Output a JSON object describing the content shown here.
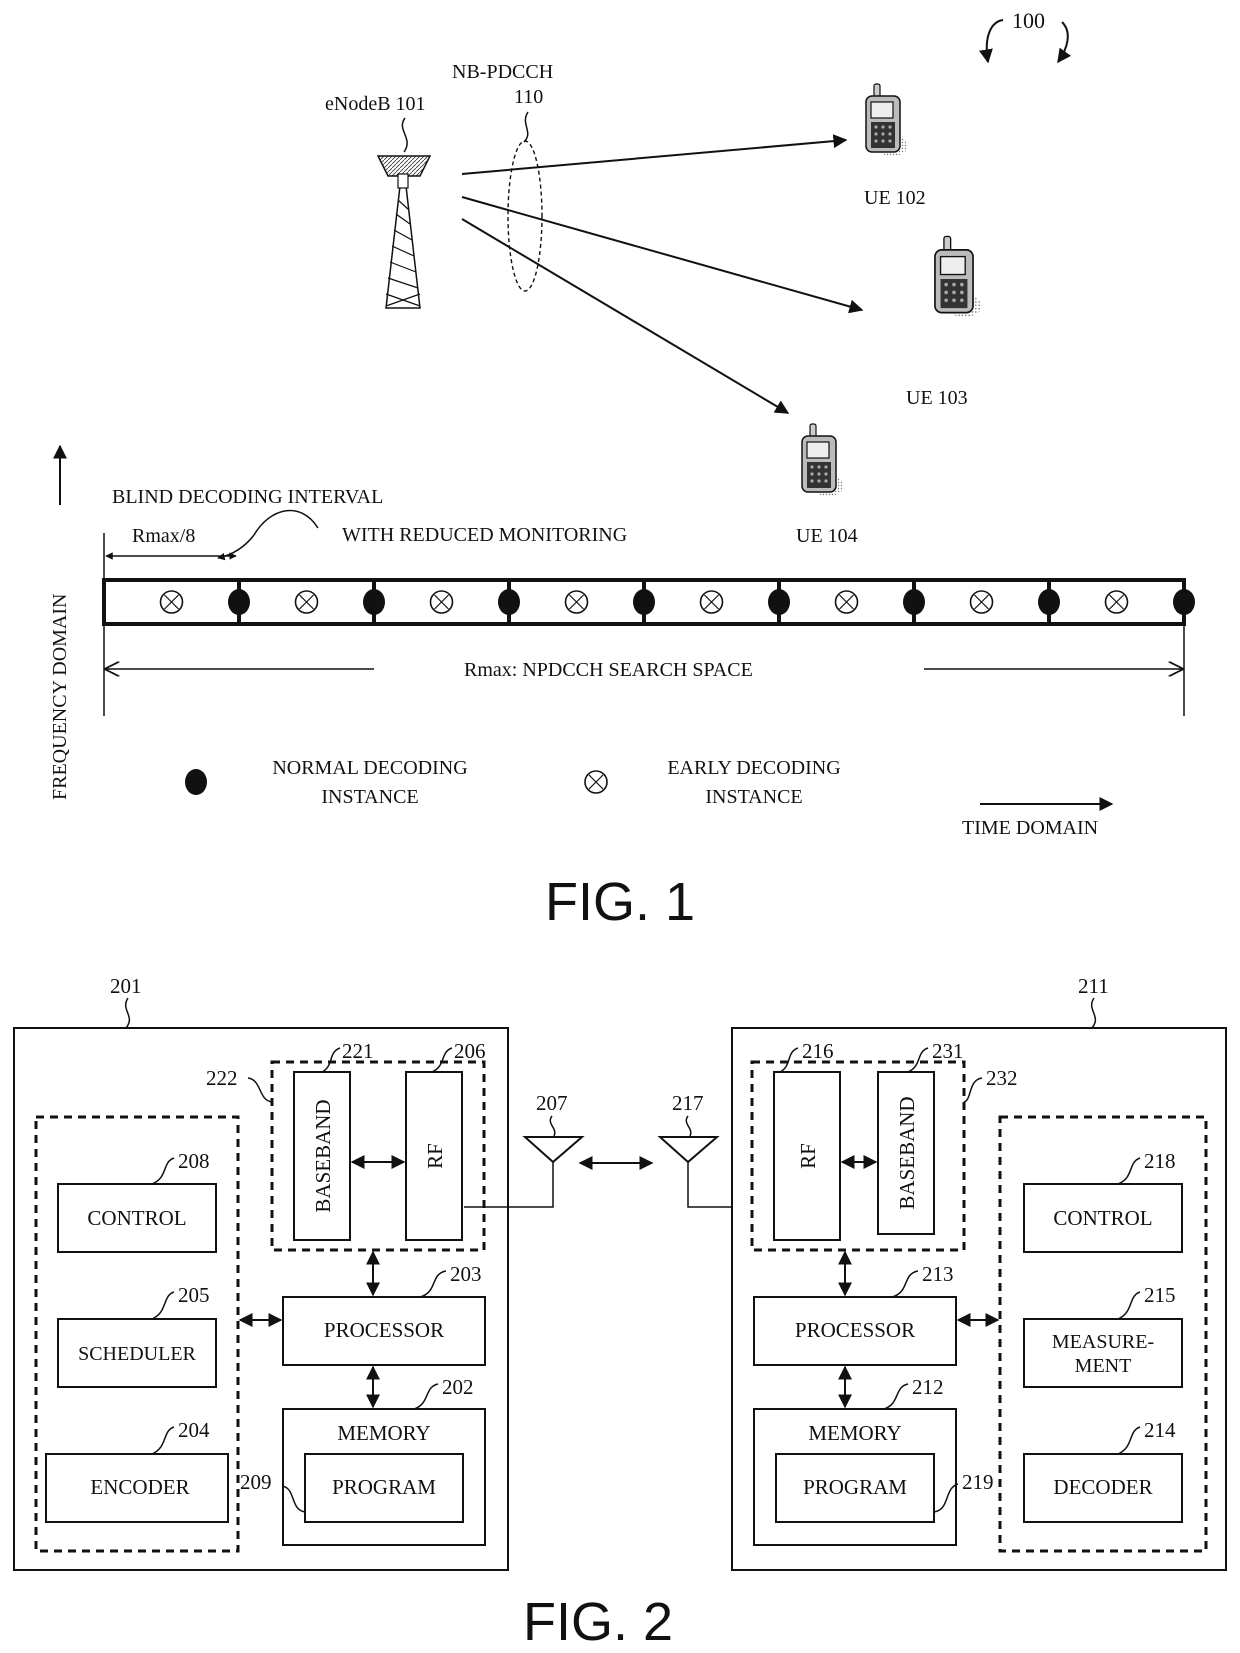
{
  "fig1": {
    "ref_label": "100",
    "enodeb_label": "eNodeB 101",
    "nbpdcch_label": "NB-PDCCH",
    "nbpdcch_ref": "110",
    "ue_labels": [
      "UE 102",
      "UE 103",
      "UE 104"
    ],
    "blind_decoding_line1": "BLIND DECODING INTERVAL",
    "blind_decoding_line2": "WITH REDUCED MONITORING",
    "rmax8_label": "Rmax/8",
    "search_space_label": "Rmax: NPDCCH SEARCH SPACE",
    "frequency_axis_label": "FREQUENCY DOMAIN",
    "time_axis_label": "TIME DOMAIN",
    "legend": {
      "normal_line1": "NORMAL DECODING",
      "normal_line2": "INSTANCE",
      "early_line1": "EARLY DECODING",
      "early_line2": "INSTANCE"
    },
    "interval_count": 8,
    "caption": "FIG. 1"
  },
  "fig2": {
    "caption": "FIG. 2",
    "link_antennas": [
      "207",
      "217"
    ],
    "device_left": {
      "ref": "201",
      "rf_group_ref": "222",
      "baseband": {
        "ref": "221",
        "label": "BASEBAND"
      },
      "rf": {
        "ref": "206",
        "label": "RF"
      },
      "processor": {
        "ref": "203",
        "label": "PROCESSOR"
      },
      "memory": {
        "ref": "202",
        "label": "MEMORY"
      },
      "program": {
        "ref": "209",
        "label": "PROGRAM"
      },
      "modules": [
        {
          "ref": "208",
          "label": "CONTROL"
        },
        {
          "ref": "205",
          "label": "SCHEDULER"
        },
        {
          "ref": "204",
          "label": "ENCODER"
        }
      ]
    },
    "device_right": {
      "ref": "211",
      "rf_group_ref": "232",
      "rf": {
        "ref": "216",
        "label": "RF"
      },
      "baseband": {
        "ref": "231",
        "label": "BASEBAND"
      },
      "processor": {
        "ref": "213",
        "label": "PROCESSOR"
      },
      "memory": {
        "ref": "212",
        "label": "MEMORY"
      },
      "program": {
        "ref": "219",
        "label": "PROGRAM"
      },
      "modules": [
        {
          "ref": "218",
          "label": "CONTROL"
        },
        {
          "ref": "215",
          "label": "MEASURE-",
          "label2": "MENT"
        },
        {
          "ref": "214",
          "label": "DECODER"
        }
      ]
    }
  }
}
